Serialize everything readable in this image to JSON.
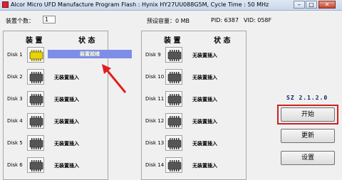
{
  "window": {
    "title": "Alcor Micro UFD Manufacture Program Flash : Hynix HY27UU088G5M, Cycle Time : 50 MHz"
  },
  "info": {
    "device_count_label": "装置个数：",
    "device_count_value": "1",
    "capacity": "预设容量：0 MB",
    "pid": "PID: 6387",
    "vid": "VID: 058F"
  },
  "headers": {
    "device": "装 置",
    "status": "状 态"
  },
  "left_disks": [
    {
      "label": "Disk 1",
      "status": "装置就绪"
    },
    {
      "label": "Disk 2",
      "status": "无装置插入"
    },
    {
      "label": "Disk 3",
      "status": "无装置插入"
    },
    {
      "label": "Disk 4",
      "status": "无装置插入"
    },
    {
      "label": "Disk 5",
      "status": "无装置插入"
    },
    {
      "label": "Disk 6",
      "status": "无装置插入"
    }
  ],
  "right_disks": [
    {
      "label": "Disk 9",
      "status": "无装置插入"
    },
    {
      "label": "Disk 10",
      "status": "无装置插入"
    },
    {
      "label": "Disk 11",
      "status": "无装置插入"
    },
    {
      "label": "Disk 12",
      "status": "无装置插入"
    },
    {
      "label": "Disk 13",
      "status": "无装置插入"
    },
    {
      "label": "Disk 14",
      "status": "无装置插入"
    }
  ],
  "version": "SZ 2.1.2.0",
  "buttons": {
    "start": "开始",
    "refresh": "更新",
    "settings": "设置"
  },
  "colors": {
    "ready_bg": "#7d8de8",
    "ready_text": "#ffffcc",
    "chip_active": "#e8d400",
    "highlight": "#d02020"
  }
}
